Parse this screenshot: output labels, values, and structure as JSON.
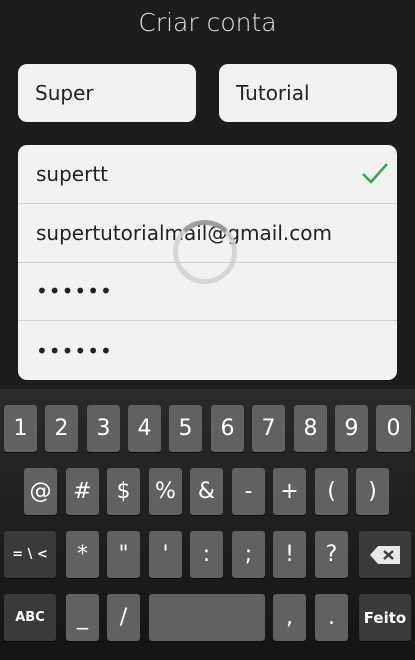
{
  "title": "Criar conta",
  "first_name": "Super",
  "last_name": "Tutorial",
  "username": "supertt",
  "email": "supertutorialmail@gmail.com",
  "password": "••••••",
  "password_confirm": "••••••",
  "colors": {
    "check": "#3aa64a"
  },
  "keyboard": {
    "row1": [
      "1",
      "2",
      "3",
      "4",
      "5",
      "6",
      "7",
      "8",
      "9",
      "0"
    ],
    "row2": [
      "@",
      "#",
      "$",
      "%",
      "&",
      "-",
      "+",
      "(",
      ")"
    ],
    "row3": [
      "*",
      "\"",
      "'",
      ":",
      ";",
      "!",
      "?"
    ],
    "alt_key": "= \\ <",
    "abc_key": "ABC",
    "underscore_key": "_",
    "slash_key": "/",
    "comma_key": ",",
    "period_key": ".",
    "done_key": "Feito",
    "delete_icon": "backspace-icon"
  }
}
